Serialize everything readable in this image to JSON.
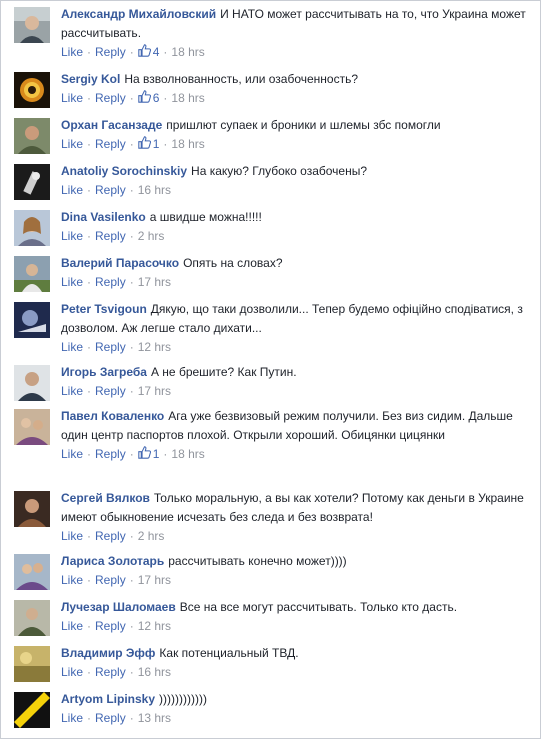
{
  "ui": {
    "like_label": "Like",
    "reply_label": "Reply",
    "separator": "·"
  },
  "comments": [
    {
      "author": "Александр Михайловский",
      "text": "И НАТО может рассчитывать на то, что Украина может рассчитывать.",
      "likes": "4",
      "time": "18 hrs"
    },
    {
      "author": "Sergiy Kol",
      "text": "На взволнованность, или озабоченность?",
      "likes": "6",
      "time": "18 hrs"
    },
    {
      "author": "Орхан Гасанзаде",
      "text": "пришлют супаек и броники и шлемы збс помогли",
      "likes": "1",
      "time": "18 hrs"
    },
    {
      "author": "Anatoliy Sorochinskiy",
      "text": "На какую? Глубоко озабочены?",
      "likes": "",
      "time": "16 hrs"
    },
    {
      "author": "Dina Vasilenko",
      "text": "а швидше можна!!!!!",
      "likes": "",
      "time": "2 hrs"
    },
    {
      "author": "Валерий Парасочко",
      "text": "Опять на словах?",
      "likes": "",
      "time": "17 hrs"
    },
    {
      "author": "Peter Tsvigoun",
      "text": "Дякую, що таки дозволили... Тепер будемо офіційно сподіватися, з дозволом. Аж легше стало дихати...",
      "likes": "",
      "time": "12 hrs"
    },
    {
      "author": "Игорь Загреба",
      "text": "А не брешите? Как Путин.",
      "likes": "",
      "time": "17 hrs"
    },
    {
      "author": "Павел Коваленко",
      "text": "Ага уже безвизовый режим получили. Без виз сидим. Дальше один центр паспортов плохой. Открыли хороший. Обицянки цицянки",
      "likes": "1",
      "time": "18 hrs"
    },
    {
      "author": "Сергей Вялков",
      "text": "Только моральную, а вы как хотели? Потому как деньги в Украине имеют обыкновение исчезать без следа и без возврата!",
      "likes": "",
      "time": "2 hrs"
    },
    {
      "author": "Лариса Золотарь",
      "text": "рассчитывать конечно может))))",
      "likes": "",
      "time": "17 hrs"
    },
    {
      "author": "Лучезар Шаломаев",
      "text": "Все на все могут рассчитывать. Только кто дасть.",
      "likes": "",
      "time": "12 hrs"
    },
    {
      "author": "Владимир Эфф",
      "text": "Как потенциальный ТВД.",
      "likes": "",
      "time": "16 hrs"
    },
    {
      "author": "Artyom Lipinsky",
      "text": "))))))))))))",
      "likes": "",
      "time": "13 hrs"
    }
  ]
}
